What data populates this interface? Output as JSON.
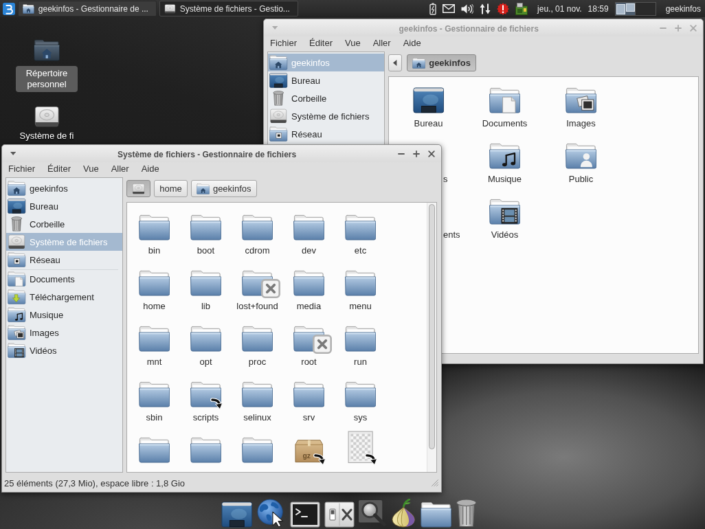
{
  "top_panel": {
    "tasks": [
      {
        "title": "geekinfos - Gestionnaire de ...",
        "kind": "home",
        "selected": false
      },
      {
        "title": "Système de fichiers - Gestio...",
        "kind": "drive",
        "selected": true
      }
    ],
    "clock": {
      "date": "jeu., 01 nov.",
      "time": "18:59"
    },
    "workspaces": [
      {
        "selected": true
      },
      {
        "selected": false
      }
    ],
    "user": "geekinfos"
  },
  "desktop_icons": [
    {
      "label": "Répertoire personnel",
      "kind": "home",
      "selected": true
    },
    {
      "label": "Système de fi",
      "kind": "drive",
      "selected": false
    }
  ],
  "windows": [
    {
      "title": "geekinfos - Gestionnaire de fichiers",
      "active": false,
      "menu": [
        "Fichier",
        "Éditer",
        "Vue",
        "Aller",
        "Aide"
      ],
      "sidebar": {
        "places": [
          {
            "label": "geekinfos",
            "kind": "home",
            "selected": true
          },
          {
            "label": "Bureau",
            "kind": "desktop",
            "selected": false
          },
          {
            "label": "Corbeille",
            "kind": "trash",
            "selected": false
          },
          {
            "label": "Système de fichiers",
            "kind": "drive",
            "selected": false
          },
          {
            "label": "Réseau",
            "kind": "network",
            "selected": false
          }
        ]
      },
      "path_scroll": true,
      "path": [
        {
          "label": "geekinfos",
          "kind": "home",
          "selected": true
        }
      ],
      "items": [
        {
          "name": "Bureau",
          "kind": "desktop",
          "covered": false
        },
        {
          "name": "Documents",
          "kind": "documents",
          "covered": false
        },
        {
          "name": "Images",
          "kind": "pictures",
          "covered": false
        },
        {
          "name": "s",
          "covered": true
        },
        {
          "name": "Musique",
          "kind": "music",
          "covered": false
        },
        {
          "name": "Public",
          "kind": "public",
          "covered": false
        },
        {
          "name": "ents",
          "covered": true
        },
        {
          "name": "Vidéos",
          "kind": "videos",
          "covered": false
        }
      ]
    },
    {
      "title": "Système de fichiers - Gestionnaire de fichiers",
      "active": true,
      "menu": [
        "Fichier",
        "Éditer",
        "Vue",
        "Aller",
        "Aide"
      ],
      "sidebar": {
        "places": [
          {
            "label": "geekinfos",
            "kind": "home",
            "selected": false
          },
          {
            "label": "Bureau",
            "kind": "desktop",
            "selected": false
          },
          {
            "label": "Corbeille",
            "kind": "trash",
            "selected": false
          },
          {
            "label": "Système de fichiers",
            "kind": "drive",
            "selected": true
          },
          {
            "label": "Réseau",
            "kind": "network",
            "selected": false
          }
        ],
        "bookmarks": [
          {
            "label": "Documents",
            "kind": "documents",
            "selected": false
          },
          {
            "label": "Téléchargement",
            "kind": "downloads",
            "selected": false
          },
          {
            "label": "Musique",
            "kind": "music",
            "selected": false
          },
          {
            "label": "Images",
            "kind": "pictures",
            "selected": false
          },
          {
            "label": "Vidéos",
            "kind": "videos",
            "selected": false
          }
        ]
      },
      "path": [
        {
          "kind": "drive",
          "selected": true
        },
        {
          "label": "home",
          "selected": false
        },
        {
          "label": "geekinfos",
          "kind": "home",
          "selected": false
        }
      ],
      "items": [
        {
          "name": "bin",
          "kind": "folder",
          "symlink": false,
          "no_access": false
        },
        {
          "name": "boot",
          "kind": "folder",
          "symlink": false,
          "no_access": false
        },
        {
          "name": "cdrom",
          "kind": "folder",
          "symlink": false,
          "no_access": false
        },
        {
          "name": "dev",
          "kind": "folder",
          "symlink": false,
          "no_access": false
        },
        {
          "name": "etc",
          "kind": "folder",
          "symlink": false,
          "no_access": false
        },
        {
          "name": "home",
          "kind": "folder",
          "symlink": false,
          "no_access": false
        },
        {
          "name": "lib",
          "kind": "folder",
          "symlink": false,
          "no_access": false
        },
        {
          "name": "lost+found",
          "kind": "folder",
          "symlink": false,
          "no_access": true
        },
        {
          "name": "media",
          "kind": "folder",
          "symlink": false,
          "no_access": false
        },
        {
          "name": "menu",
          "kind": "folder",
          "symlink": false,
          "no_access": false
        },
        {
          "name": "mnt",
          "kind": "folder",
          "symlink": false,
          "no_access": false
        },
        {
          "name": "opt",
          "kind": "folder",
          "symlink": false,
          "no_access": false
        },
        {
          "name": "proc",
          "kind": "folder",
          "symlink": false,
          "no_access": false
        },
        {
          "name": "root",
          "kind": "folder",
          "symlink": false,
          "no_access": true
        },
        {
          "name": "run",
          "kind": "folder",
          "symlink": false,
          "no_access": false
        },
        {
          "name": "sbin",
          "kind": "folder",
          "symlink": false,
          "no_access": false
        },
        {
          "name": "scripts",
          "kind": "folder",
          "symlink": true,
          "no_access": false
        },
        {
          "name": "selinux",
          "kind": "folder",
          "symlink": false,
          "no_access": false
        },
        {
          "name": "srv",
          "kind": "folder",
          "symlink": false,
          "no_access": false
        },
        {
          "name": "sys",
          "kind": "folder",
          "symlink": false,
          "no_access": false
        },
        {
          "kind": "folder",
          "symlink": false,
          "no_access": false
        },
        {
          "kind": "folder",
          "symlink": false,
          "no_access": false
        },
        {
          "kind": "folder",
          "symlink": false,
          "no_access": false
        },
        {
          "kind": "archive",
          "symlink": true,
          "no_access": false,
          "type_label": "gz"
        },
        {
          "kind": "file",
          "symlink": true,
          "no_access": false
        }
      ],
      "status": "25 éléments (27,3 Mio), espace libre : 1,8 Gio"
    }
  ],
  "dock": [
    {
      "kind": "desktop"
    },
    {
      "kind": "globe"
    },
    {
      "kind": "terminal"
    },
    {
      "kind": "settings"
    },
    {
      "kind": "search"
    },
    {
      "kind": "onion"
    },
    {
      "kind": "folder"
    },
    {
      "kind": "trash"
    }
  ]
}
